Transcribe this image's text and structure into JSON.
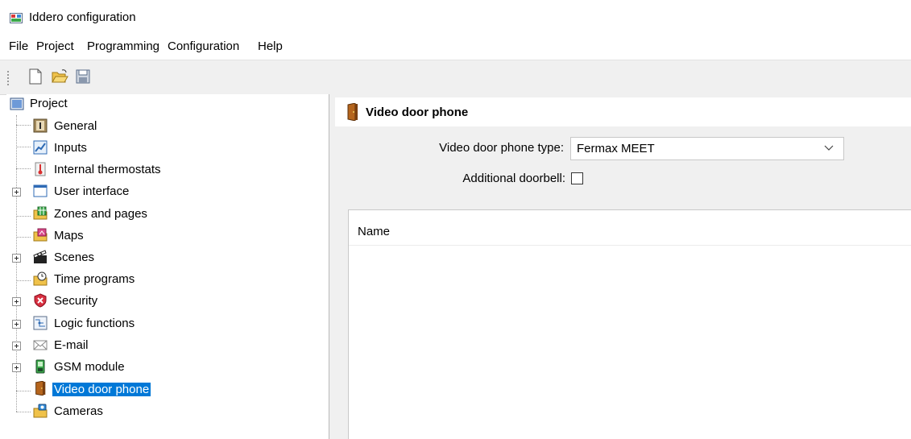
{
  "window": {
    "title": "Iddero configuration"
  },
  "menu": {
    "items": [
      {
        "label": "File"
      },
      {
        "label": "Project"
      },
      {
        "label": "Programming"
      },
      {
        "label": "Configuration"
      },
      {
        "label": "Help"
      }
    ]
  },
  "toolbar": {
    "buttons": [
      {
        "icon": "new-document-icon"
      },
      {
        "icon": "open-folder-icon"
      },
      {
        "icon": "save-disk-icon"
      }
    ]
  },
  "tree": {
    "root": {
      "label": "Project",
      "icon": "project-icon"
    },
    "items": [
      {
        "label": "General",
        "icon": "general-info-icon",
        "expandable": false
      },
      {
        "label": "Inputs",
        "icon": "inputs-chart-icon",
        "expandable": false
      },
      {
        "label": "Internal thermostats",
        "icon": "thermostat-icon",
        "expandable": false
      },
      {
        "label": "User interface",
        "icon": "window-icon",
        "expandable": true
      },
      {
        "label": "Zones and pages",
        "icon": "zones-folder-icon",
        "expandable": false
      },
      {
        "label": "Maps",
        "icon": "maps-folder-icon",
        "expandable": false
      },
      {
        "label": "Scenes",
        "icon": "clapperboard-icon",
        "expandable": true
      },
      {
        "label": "Time programs",
        "icon": "clock-folder-icon",
        "expandable": false
      },
      {
        "label": "Security",
        "icon": "security-shield-icon",
        "expandable": true
      },
      {
        "label": "Logic functions",
        "icon": "logic-diagram-icon",
        "expandable": true
      },
      {
        "label": "E-mail",
        "icon": "envelope-icon",
        "expandable": true
      },
      {
        "label": "GSM module",
        "icon": "phone-module-icon",
        "expandable": true
      },
      {
        "label": "Video door phone",
        "icon": "door-icon",
        "expandable": false,
        "selected": true
      },
      {
        "label": "Cameras",
        "icon": "camera-folder-icon",
        "expandable": false
      }
    ]
  },
  "panel": {
    "title": "Video door phone",
    "type_label": "Video door phone type:",
    "type_value": "Fermax MEET",
    "doorbell_label": "Additional doorbell:",
    "doorbell_checked": false,
    "list": {
      "columns": [
        {
          "label": "Name"
        }
      ]
    }
  },
  "colors": {
    "selection": "#0078d7",
    "toolbar_bg": "#f0f0f0",
    "pane_bg": "#f0f0f0"
  }
}
